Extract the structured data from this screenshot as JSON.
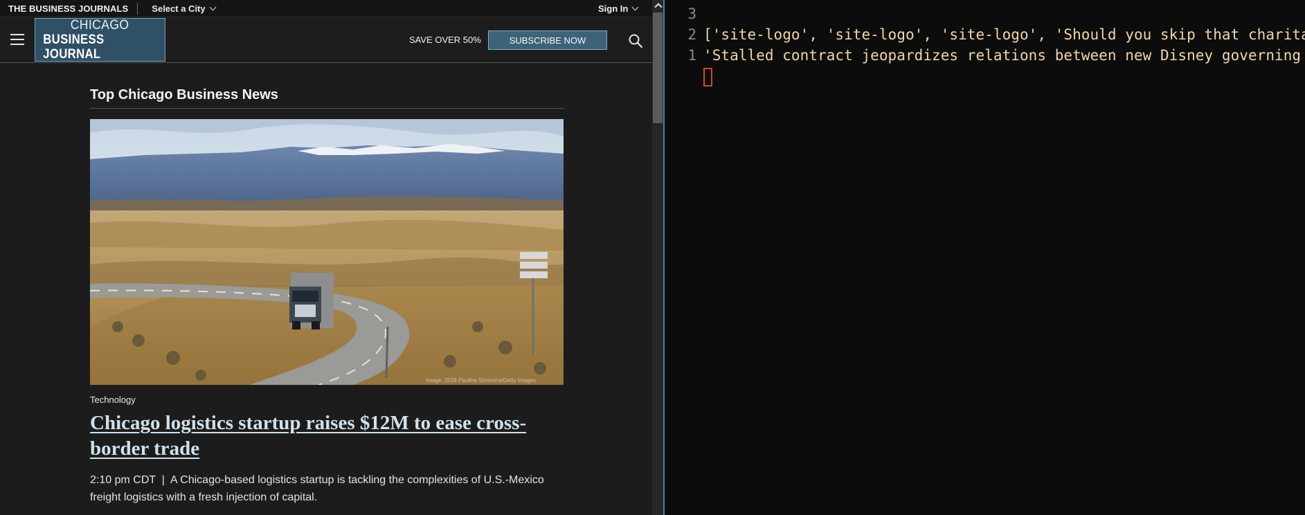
{
  "browser": {
    "topbar": {
      "brand": "THE BUSINESS JOURNALS",
      "city_select": "Select a City",
      "sign_in": "Sign In"
    },
    "header": {
      "logo_line1": "CHICAGO",
      "logo_line2": "BUSINESS JOURNAL",
      "promo": "SAVE OVER 50%",
      "subscribe": "SUBSCRIBE NOW"
    },
    "main": {
      "section_title": "Top Chicago Business News",
      "article": {
        "category": "Technology",
        "headline": "Chicago logistics startup raises $12M to ease cross-border trade",
        "time": "2:10 pm CDT",
        "separator": "|",
        "summary": "A Chicago-based logistics startup is tackling the complexities of U.S.-Mexico freight logistics with a fresh injection of capital.",
        "image_credit": "Image: 2018 Pauline Simmons/Getty Images"
      }
    }
  },
  "editor": {
    "lines": [
      {
        "num": "3",
        "text": ""
      },
      {
        "num": "2",
        "text": "['site-logo', 'site-logo', 'site-logo', 'Should you skip that charitable"
      },
      {
        "num": "1",
        "text": " 'Stalled contract jeopardizes relations between new Disney governing bod"
      }
    ]
  },
  "colors": {
    "logo_bg": "#2f5066",
    "subscribe_bg": "#3c6378",
    "headline": "#cfe1ec",
    "code_text": "#efd7a8",
    "cursor": "#d24a24",
    "divider_accent": "#3a8f8f"
  }
}
